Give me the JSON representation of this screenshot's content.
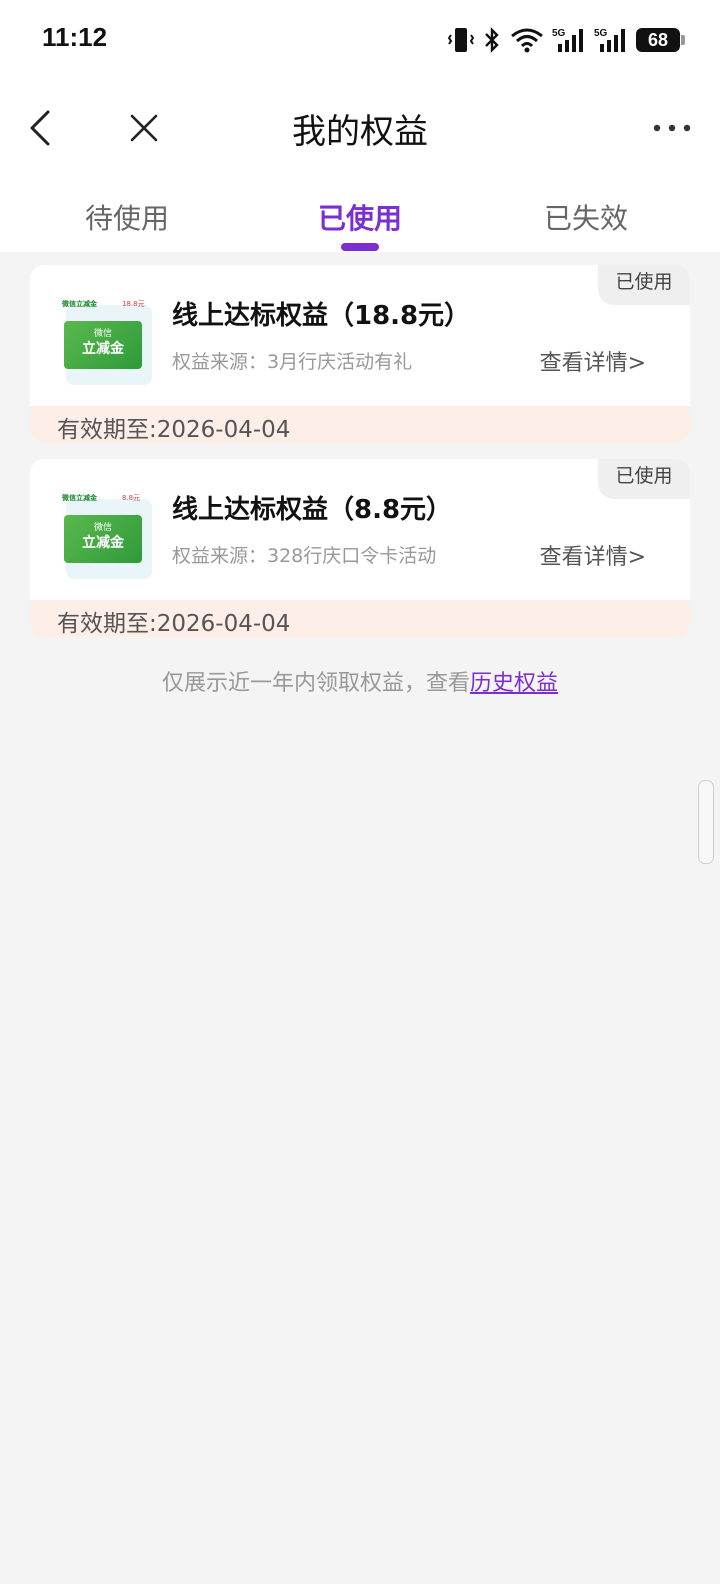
{
  "status_bar": {
    "time": "11:12",
    "battery": "68",
    "icons": [
      "vibrate-icon",
      "bluetooth-icon",
      "wifi-icon",
      "5g-signal-icon",
      "5g-signal-icon",
      "battery-icon"
    ]
  },
  "nav": {
    "title": "我的权益",
    "icons": [
      "back-icon",
      "close-icon",
      "more-icon"
    ]
  },
  "tabs": [
    {
      "label": "待使用",
      "active": false
    },
    {
      "label": "已使用",
      "active": true
    },
    {
      "label": "已失效",
      "active": false
    }
  ],
  "cards": [
    {
      "badge": "已使用",
      "voucher_top": "微信立减金",
      "voucher_amount": "18.8元",
      "voucher_line1": "微信",
      "voucher_line2": "立减金",
      "title": "线上达标权益（18.8元）",
      "source": "权益来源：3月行庆活动有礼",
      "detail": "查看详情>",
      "expiry": "有效期至:2026-04-04"
    },
    {
      "badge": "已使用",
      "voucher_top": "微信立减金",
      "voucher_amount": "8.8元",
      "voucher_line1": "微信",
      "voucher_line2": "立减金",
      "title": "线上达标权益（8.8元）",
      "source": "权益来源：328行庆口令卡活动",
      "detail": "查看详情>",
      "expiry": "有效期至:2026-04-04"
    }
  ],
  "footer": {
    "text": "仅展示近一年内领取权益，查看",
    "link": "历史权益"
  },
  "colors": {
    "accent": "#7b2fd3",
    "expiry_bg": "#fdeee8",
    "page_bg": "#f4f4f4"
  }
}
